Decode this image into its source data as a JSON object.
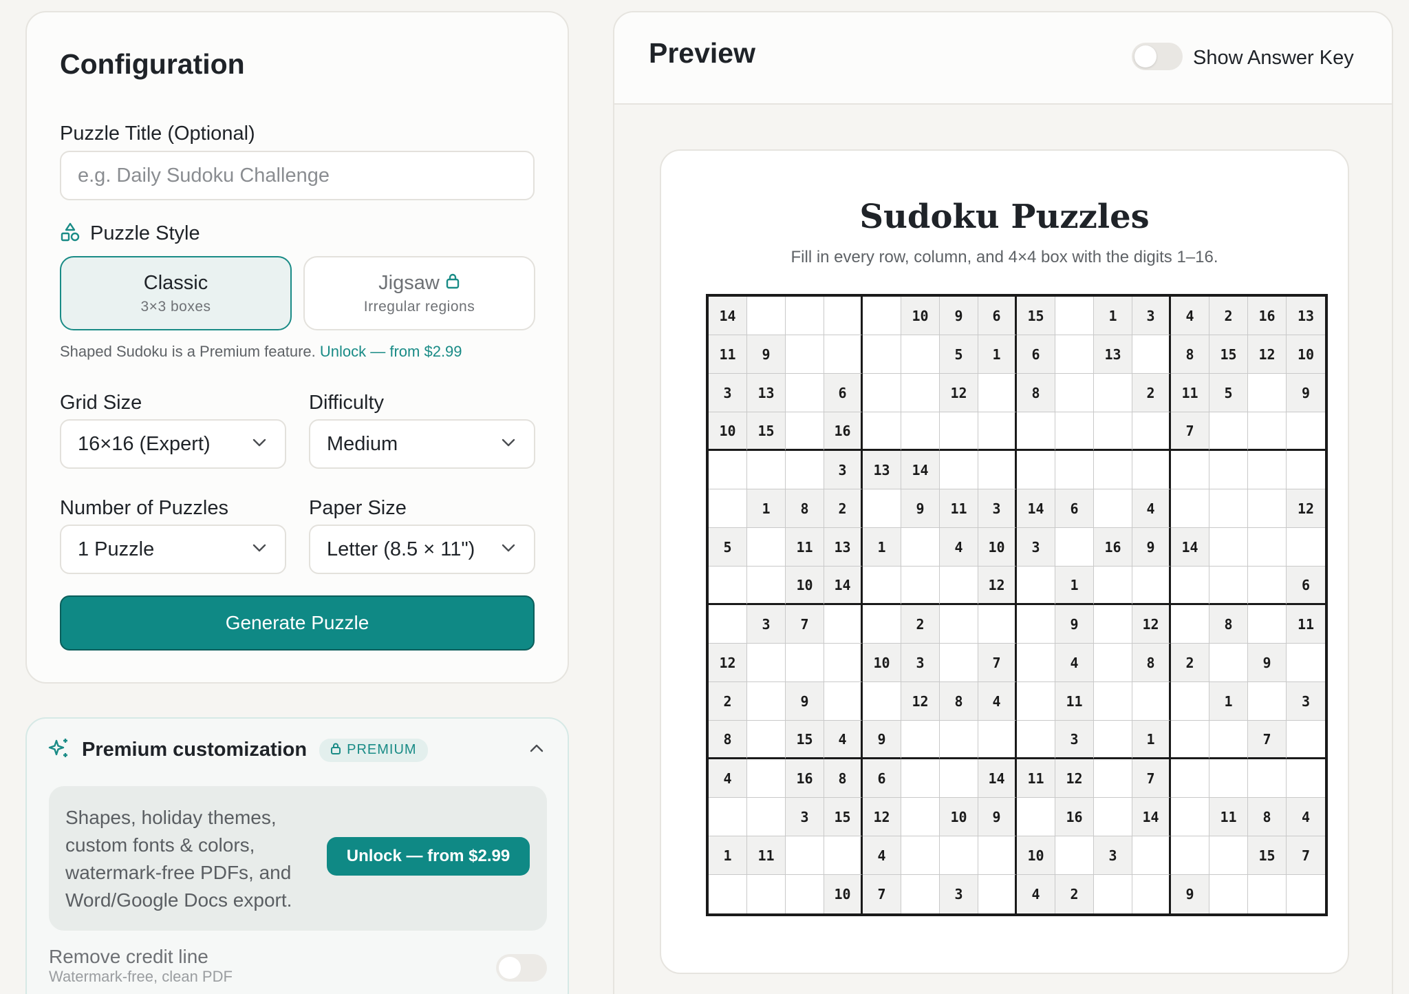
{
  "config": {
    "title": "Configuration",
    "puzzle_title_label": "Puzzle Title (Optional)",
    "puzzle_title_placeholder": "e.g. Daily Sudoku Challenge",
    "puzzle_title_value": "",
    "puzzle_style_label": "Puzzle Style",
    "styles": [
      {
        "name": "Classic",
        "sub": "3×3 boxes",
        "selected": true,
        "locked": false
      },
      {
        "name": "Jigsaw",
        "sub": "Irregular regions",
        "selected": false,
        "locked": true
      }
    ],
    "premium_note": "Shaped Sudoku is a Premium feature.",
    "premium_note_link": "Unlock — from $2.99",
    "grid_size_label": "Grid Size",
    "grid_size_value": "16×16 (Expert)",
    "difficulty_label": "Difficulty",
    "difficulty_value": "Medium",
    "num_puzzles_label": "Number of Puzzles",
    "num_puzzles_value": "1 Puzzle",
    "paper_size_label": "Paper Size",
    "paper_size_value": "Letter (8.5 × 11\")",
    "generate_label": "Generate Puzzle"
  },
  "premium": {
    "title": "Premium customization",
    "badge": "PREMIUM",
    "description": "Shapes, holiday themes, custom fonts & colors, watermark-free PDFs, and Word/Google Docs export.",
    "unlock_label": "Unlock — from $2.99",
    "remove_credit_title": "Remove credit line",
    "remove_credit_sub": "Watermark-free, clean PDF",
    "remove_credit_on": false
  },
  "preview": {
    "title": "Preview",
    "answer_key_label": "Show Answer Key",
    "answer_key_on": false,
    "sheet_title": "Sudoku Puzzles",
    "sheet_subtitle": "Fill in every row, column, and 4×4 box with the digits 1–16.",
    "grid": [
      [
        14,
        0,
        0,
        0,
        0,
        10,
        9,
        6,
        15,
        0,
        1,
        3,
        4,
        2,
        16,
        13
      ],
      [
        11,
        9,
        0,
        0,
        0,
        0,
        5,
        1,
        6,
        0,
        13,
        0,
        8,
        15,
        12,
        10
      ],
      [
        3,
        13,
        0,
        6,
        0,
        0,
        12,
        0,
        8,
        0,
        0,
        2,
        11,
        5,
        0,
        9
      ],
      [
        10,
        15,
        0,
        16,
        0,
        0,
        0,
        0,
        0,
        0,
        0,
        0,
        7,
        0,
        0,
        0
      ],
      [
        0,
        0,
        0,
        3,
        13,
        14,
        0,
        0,
        0,
        0,
        0,
        0,
        0,
        0,
        0,
        0
      ],
      [
        0,
        1,
        8,
        2,
        0,
        9,
        11,
        3,
        14,
        6,
        0,
        4,
        0,
        0,
        0,
        12
      ],
      [
        5,
        0,
        11,
        13,
        1,
        0,
        4,
        10,
        3,
        0,
        16,
        9,
        14,
        0,
        0,
        0
      ],
      [
        0,
        0,
        10,
        14,
        0,
        0,
        0,
        12,
        0,
        1,
        0,
        0,
        0,
        0,
        0,
        6
      ],
      [
        0,
        3,
        7,
        0,
        0,
        2,
        0,
        0,
        0,
        9,
        0,
        12,
        0,
        8,
        0,
        11
      ],
      [
        12,
        0,
        0,
        0,
        10,
        3,
        0,
        7,
        0,
        4,
        0,
        8,
        2,
        0,
        9,
        0
      ],
      [
        2,
        0,
        9,
        0,
        0,
        12,
        8,
        4,
        0,
        11,
        0,
        0,
        0,
        1,
        0,
        3
      ],
      [
        8,
        0,
        15,
        4,
        9,
        0,
        0,
        0,
        0,
        3,
        0,
        1,
        0,
        0,
        7,
        0
      ],
      [
        4,
        0,
        16,
        8,
        6,
        0,
        0,
        14,
        11,
        12,
        0,
        7,
        0,
        0,
        0,
        0
      ],
      [
        0,
        0,
        3,
        15,
        12,
        0,
        10,
        9,
        0,
        16,
        0,
        14,
        0,
        11,
        8,
        4
      ],
      [
        1,
        11,
        0,
        0,
        4,
        0,
        0,
        0,
        10,
        0,
        3,
        0,
        0,
        0,
        15,
        7
      ],
      [
        0,
        0,
        0,
        10,
        7,
        0,
        3,
        0,
        4,
        2,
        0,
        0,
        9,
        0,
        0,
        0
      ]
    ]
  }
}
